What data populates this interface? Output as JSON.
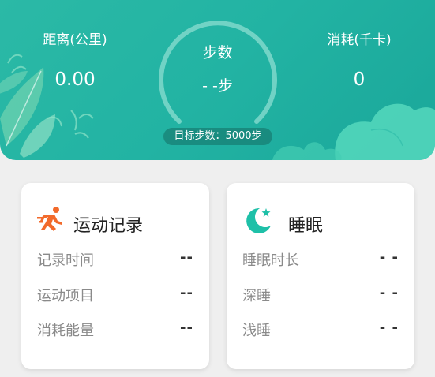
{
  "header": {
    "distance": {
      "label": "距离(公里)",
      "value": "0.00"
    },
    "calories": {
      "label": "消耗(千卡)",
      "value": "0"
    },
    "steps": {
      "title": "步数",
      "value": "- -步"
    },
    "target": "目标步数：5000步"
  },
  "exercise_card": {
    "title": "运动记录",
    "icon": "running-person-icon",
    "rows": [
      {
        "label": "记录时间",
        "value": "--"
      },
      {
        "label": "运动项目",
        "value": "--"
      },
      {
        "label": "消耗能量",
        "value": "--"
      }
    ]
  },
  "sleep_card": {
    "title": "睡眠",
    "icon": "moon-star-icon",
    "rows": [
      {
        "label": "睡眠时长",
        "value": "- -"
      },
      {
        "label": "深睡",
        "value": "- -"
      },
      {
        "label": "浅睡",
        "value": "- -"
      }
    ]
  },
  "colors": {
    "header": "#22b3a3",
    "exercise_icon": "#f26a2b",
    "sleep_icon": "#1ec0a8"
  }
}
